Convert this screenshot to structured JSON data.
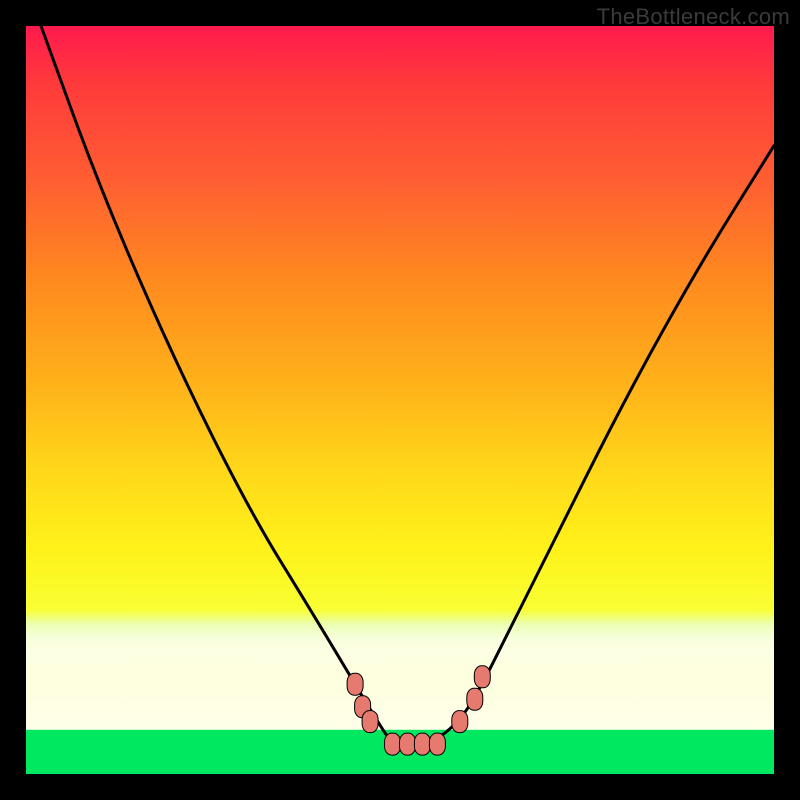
{
  "watermark": "TheBottleneck.com",
  "colors": {
    "gradient_top": "#ff1a4d",
    "gradient_mid1": "#ff8a1f",
    "gradient_mid2": "#ffd91a",
    "gradient_pale": "#fcffef",
    "gradient_bottom": "#00e860",
    "curve": "#000000",
    "marker_fill": "#e77a6f",
    "marker_stroke": "#000000",
    "frame": "#000000"
  },
  "chart_data": {
    "type": "line",
    "title": "",
    "xlabel": "",
    "ylabel": "",
    "xlim": [
      0,
      100
    ],
    "ylim": [
      0,
      100
    ],
    "grid": false,
    "legend": false,
    "series": [
      {
        "name": "bottleneck-curve",
        "x": [
          2,
          10,
          20,
          30,
          38,
          44,
          47,
          49,
          51,
          54,
          58,
          61,
          64,
          70,
          80,
          90,
          100
        ],
        "y": [
          100,
          78,
          55,
          35,
          22,
          12,
          7,
          4,
          4,
          4,
          7,
          12,
          18,
          30,
          50,
          68,
          84
        ]
      }
    ],
    "markers": [
      {
        "name": "left-1",
        "x": 44,
        "y": 12
      },
      {
        "name": "left-2",
        "x": 45,
        "y": 9
      },
      {
        "name": "left-3",
        "x": 46,
        "y": 7
      },
      {
        "name": "flat-1",
        "x": 49,
        "y": 4
      },
      {
        "name": "flat-2",
        "x": 51,
        "y": 4
      },
      {
        "name": "flat-3",
        "x": 53,
        "y": 4
      },
      {
        "name": "flat-4",
        "x": 55,
        "y": 4
      },
      {
        "name": "right-1",
        "x": 58,
        "y": 7
      },
      {
        "name": "right-2",
        "x": 60,
        "y": 10
      },
      {
        "name": "right-3",
        "x": 61,
        "y": 13
      }
    ]
  }
}
